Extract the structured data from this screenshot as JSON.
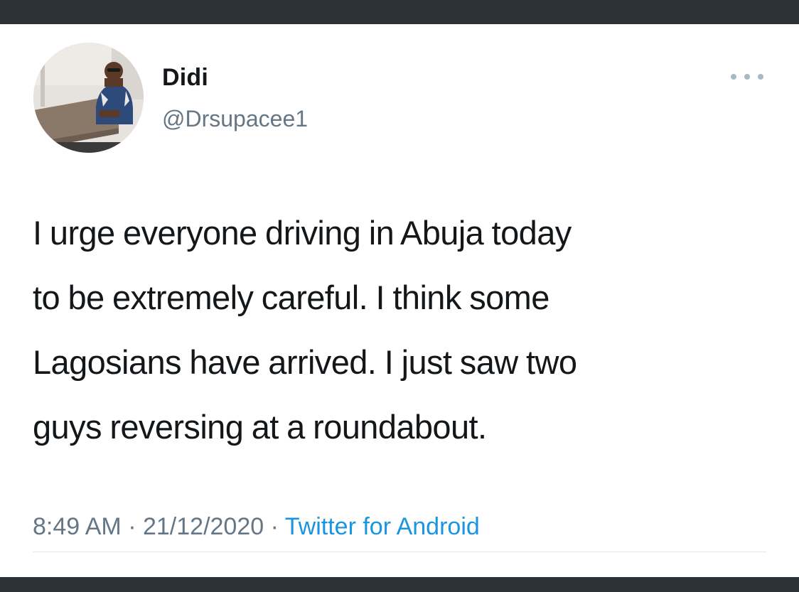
{
  "tweet": {
    "author": {
      "display_name": "Didi",
      "handle": "@Drsupacee1"
    },
    "more_icon": "more-horizontal-icon",
    "text_lines": [
      "I urge everyone driving in Abuja today",
      "to be extremely careful. I think some",
      "Lagosians have arrived. I just saw two",
      "guys reversing at a roundabout."
    ],
    "time": "8:49 AM",
    "separator": "·",
    "date": "21/12/2020",
    "source": "Twitter for Android"
  },
  "colors": {
    "frame": "#2b3338",
    "card_background": "#ffffff",
    "text": "#14171a",
    "muted": "#657786",
    "link": "#1b95e0"
  }
}
